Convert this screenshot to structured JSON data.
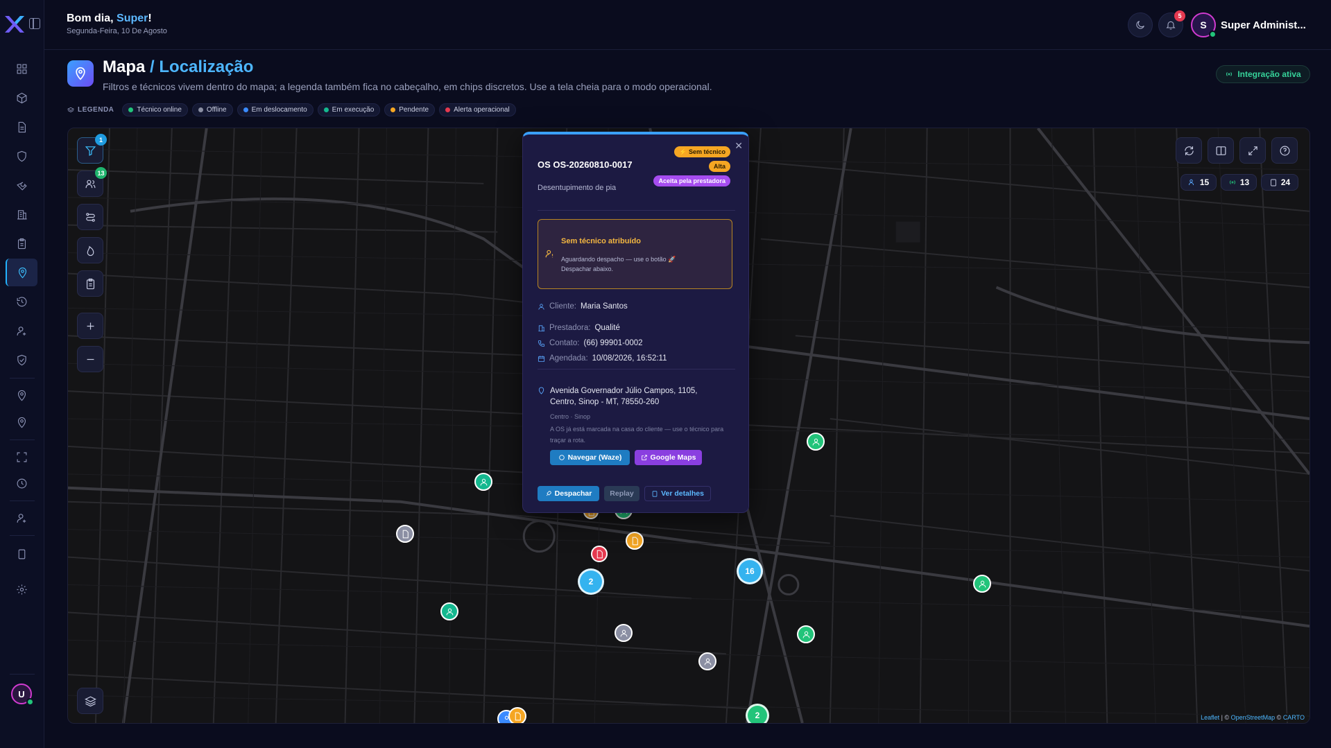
{
  "header": {
    "greeting_prefix": "Bom dia, ",
    "greeting_name": "Super",
    "greeting_suffix": "!",
    "date": "Segunda-Feira, 10 De Agosto",
    "notifications_count": "5",
    "profile_initial": "S",
    "profile_name": "Super Administ..."
  },
  "sidebar": {
    "user_initial": "U",
    "items": [
      "dashboard-icon",
      "box-icon",
      "document-icon",
      "shield-icon",
      "wrench-icon",
      "building-icon",
      "clipboard-icon",
      "map-pin-icon",
      "history-icon",
      "user-gear-icon",
      "shield-check-icon",
      "location-icon",
      "location-alt-icon",
      "fullscreen-icon",
      "clock-icon",
      "user-settings-icon",
      "tablet-icon",
      "settings-icon"
    ],
    "active": "map-pin-icon"
  },
  "page": {
    "title": "Mapa",
    "crumb": "/ Localização",
    "subtitle": "Filtros e técnicos vivem dentro do mapa; a legenda também fica no cabeçalho, em chips discretos. Use a tela cheia para o modo operacional.",
    "integration": "Integração ativa"
  },
  "legend": {
    "label": "LEGENDA",
    "items": [
      {
        "label": "Técnico online",
        "color": "#22c47a"
      },
      {
        "label": "Offline",
        "color": "#8b8fa3"
      },
      {
        "label": "Em deslocamento",
        "color": "#3a8bff"
      },
      {
        "label": "Em execução",
        "color": "#14b88f"
      },
      {
        "label": "Pendente",
        "color": "#f5a623"
      },
      {
        "label": "Alerta operacional",
        "color": "#e5394f"
      }
    ]
  },
  "map_controls": {
    "filter_badge": "1",
    "technicians_badge": "13",
    "stats": {
      "technicians": "15",
      "online": "13",
      "orders": "24"
    }
  },
  "clusters": [
    "2",
    "16",
    "2"
  ],
  "attribution": {
    "leaflet": "Leaflet",
    "sep": " | © ",
    "osm": "OpenStreetMap",
    "sep2": " © ",
    "carto": "CARTO"
  },
  "popup": {
    "os_number": "OS OS-20260810-0017",
    "service_type": "Desentupimento de pia",
    "badges": {
      "no_tech": "⚡ Sem técnico",
      "priority": "Alta",
      "status": "Aceita pela prestadora"
    },
    "warning_title": "Sem técnico atribuído",
    "warning_text": "Aguardando despacho — use o botão 🚀 Despachar abaixo.",
    "client_label": "Cliente:",
    "client": "Maria Santos",
    "provider_label": "Prestadora:",
    "provider": "Qualité",
    "contact_label": "Contato:",
    "contact": "(66) 99901-0002",
    "scheduled_label": "Agendada:",
    "scheduled": "10/08/2026, 16:52:11",
    "address": "Avenida Governador Júlio Campos, 1105, Centro, Sinop - MT, 78550-260",
    "district": "Centro · Sinop",
    "note": "A OS já está marcada na casa do cliente — use o técnico para traçar a rota.",
    "waze_btn": "Navegar (Waze)",
    "gmaps_btn": "Google Maps",
    "dispatch_btn": "Despachar",
    "replay_btn": "Replay",
    "details_btn": "Ver detalhes"
  },
  "colors": {
    "accent": "#3cc0ff",
    "online": "#22c47a",
    "pending": "#f5a623",
    "alert": "#e5394f",
    "offline": "#8b8fa3",
    "cluster": "#34b3ef"
  }
}
